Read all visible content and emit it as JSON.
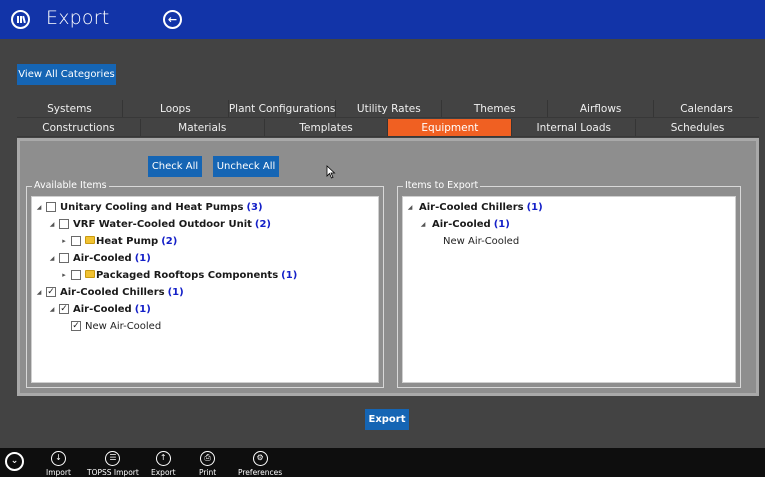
{
  "window": {
    "title": "Export"
  },
  "toolbar": {
    "view_all_label": "View All Categories"
  },
  "tabs": {
    "row1": [
      "Systems",
      "Loops",
      "Plant Configurations",
      "Utility Rates",
      "Themes",
      "Airflows",
      "Calendars"
    ],
    "row2": [
      "Constructions",
      "Materials",
      "Templates",
      "Equipment",
      "Internal Loads",
      "Schedules"
    ],
    "active": "Equipment"
  },
  "actions": {
    "check_all": "Check All",
    "uncheck_all": "Uncheck All",
    "export": "Export"
  },
  "available": {
    "legend": "Available Items",
    "items": [
      {
        "label": "Unitary Cooling and Heat Pumps",
        "count": "(3)"
      },
      {
        "label": "VRF Water-Cooled Outdoor Unit",
        "count": "(2)"
      },
      {
        "label": "Heat Pump",
        "count": "(2)"
      },
      {
        "label": "Air-Cooled",
        "count": "(1)"
      },
      {
        "label": "Packaged Rooftops Components",
        "count": "(1)"
      },
      {
        "label": "Air-Cooled Chillers",
        "count": "(1)"
      },
      {
        "label": "Air-Cooled",
        "count": "(1)"
      },
      {
        "label": "New Air-Cooled"
      }
    ]
  },
  "export_list": {
    "legend": "Items to Export",
    "items": [
      {
        "label": "Air-Cooled Chillers",
        "count": "(1)"
      },
      {
        "label": "Air-Cooled",
        "count": "(1)"
      },
      {
        "label": "New Air-Cooled"
      }
    ]
  },
  "appbar": {
    "import": "Import",
    "topss_import": "TOPSS Import",
    "export": "Export",
    "print": "Print",
    "preferences": "Preferences"
  },
  "colors": {
    "titlebar": "#1234a8",
    "accent_tab": "#f06022",
    "button": "#1565b4",
    "count": "#1420c8"
  }
}
